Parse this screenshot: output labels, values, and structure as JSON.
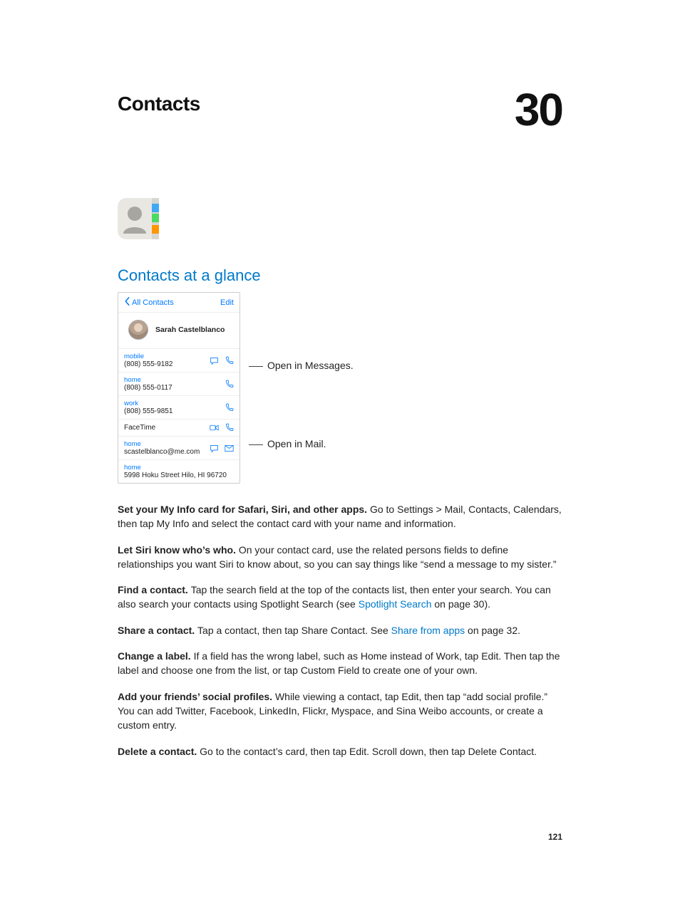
{
  "chapter_title": "Contacts",
  "chapter_number": "30",
  "section_heading": "Contacts at a glance",
  "phone": {
    "back_label": "All Contacts",
    "edit_label": "Edit",
    "contact_name": "Sarah Castelblanco",
    "rows": {
      "mobile_label": "mobile",
      "mobile_value": "(808) 555-9182",
      "home_phone_label": "home",
      "home_phone_value": "(808) 555-0117",
      "work_label": "work",
      "work_value": "(808) 555-9851",
      "facetime_label": "FaceTime",
      "email_label": "home",
      "email_value": "scastelblanco@me.com",
      "address_label": "home",
      "address_value": "5998 Hoku Street Hilo, HI 96720"
    }
  },
  "callouts": {
    "messages": "Open in Messages.",
    "mail": "Open in Mail."
  },
  "paragraphs": {
    "p1_bold": "Set your My Info card for Safari, Siri, and other apps. ",
    "p1_rest": "Go to Settings > Mail, Contacts, Calendars, then tap My Info and select the contact card with your name and information.",
    "p2_bold": "Let Siri know who’s who. ",
    "p2_rest": "On your contact card, use the related persons fields to define relationships you want Siri to know about, so you can say things like “send a message to my sister.”",
    "p3_bold": "Find a contact. ",
    "p3_rest_a": "Tap the search field at the top of the contacts list, then enter your search. You can also search your contacts using Spotlight Search (see ",
    "p3_link": "Spotlight Search",
    "p3_rest_b": " on page 30).",
    "p4_bold": "Share a contact. ",
    "p4_rest_a": "Tap a contact, then tap Share Contact. See ",
    "p4_link": "Share from apps",
    "p4_rest_b": " on page 32.",
    "p5_bold": "Change a label. ",
    "p5_rest": "If a field has the wrong label, such as Home instead of Work, tap Edit. Then tap the label and choose one from the list, or tap Custom Field to create one of your own.",
    "p6_bold": "Add your friends’ social profiles. ",
    "p6_rest": "While viewing a contact, tap Edit, then tap “add social profile.” You can add Twitter, Facebook, LinkedIn, Flickr, Myspace, and Sina Weibo accounts, or create a custom entry.",
    "p7_bold": "Delete a contact. ",
    "p7_rest": "Go to the contact’s card, then tap Edit. Scroll down, then tap Delete Contact."
  },
  "page_number": "121"
}
